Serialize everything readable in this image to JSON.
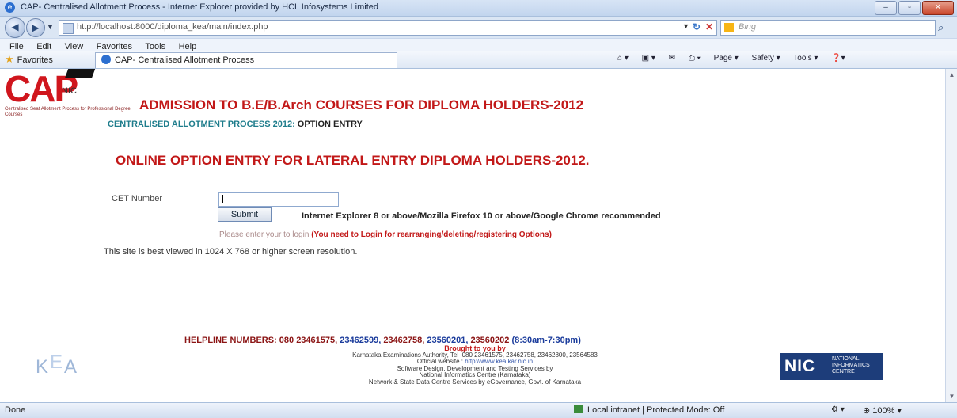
{
  "window": {
    "title": "CAP- Centralised Allotment Process - Internet Explorer provided by HCL Infosystems Limited"
  },
  "nav": {
    "url": "http://localhost:8000/diploma_kea/main/index.php",
    "search_placeholder": "Bing"
  },
  "menu": [
    "File",
    "Edit",
    "View",
    "Favorites",
    "Tools",
    "Help"
  ],
  "favorites": {
    "label": "Favorites",
    "tab": "CAP- Centralised Allotment Process"
  },
  "toolbar": {
    "page": "Page ▾",
    "safety": "Safety ▾",
    "tools": "Tools ▾"
  },
  "page": {
    "logo_text": "CAP",
    "logo_nic": "NIC",
    "logo_sub": "Centralised Seat Allotment Process for Professional Degree Courses",
    "heading": "ADMISSION TO B.E/B.Arch COURSES FOR DIPLOMA HOLDERS-2012",
    "subheading_prefix": "CENTRALISED ALLOTMENT PROCESS 2012:",
    "subheading_suffix": "OPTION ENTRY",
    "title": "ONLINE OPTION ENTRY FOR LATERAL ENTRY DIPLOMA HOLDERS-2012.",
    "cet_label": "CET Number",
    "submit_label": "Submit",
    "recommend": "Internet Explorer 8 or above/Mozilla Firefox 10 or above/Google Chrome recommended",
    "login_hint": "Please enter your to login",
    "login_note": "(You need to Login for rearranging/deleting/registering Options)",
    "best_view": "This site is best viewed in 1024 X 768 or higher screen resolution.",
    "helpline_label": "HELPLINE NUMBERS: 080 23461575,",
    "helpline_2": "23462599,",
    "helpline_3": "23462758,",
    "helpline_4": "23560201,",
    "helpline_5": "23560202",
    "helpline_time": "(8:30am-7:30pm)",
    "brought": "Brought to you by",
    "authority": "Karnataka Examinations Authority, Tel :080 23461575, 23462758, 23462800, 23564583",
    "website_label": "Official website :",
    "website": "http://www.kea.kar.nic.in",
    "design": "Software Design, Development and Testing Services by",
    "nic_centre": "National Informatics Centre (Karnataka)",
    "network": "Network & State Data Centre Services by eGovernance, Govt. of Karnataka",
    "kea_logo": "KEA",
    "nic_logo": "NIC",
    "nic_logo_text": "NATIONAL INFORMATICS CENTRE"
  },
  "status": {
    "done": "Done",
    "zone": "Local intranet | Protected Mode: Off",
    "zoom": "100%"
  }
}
